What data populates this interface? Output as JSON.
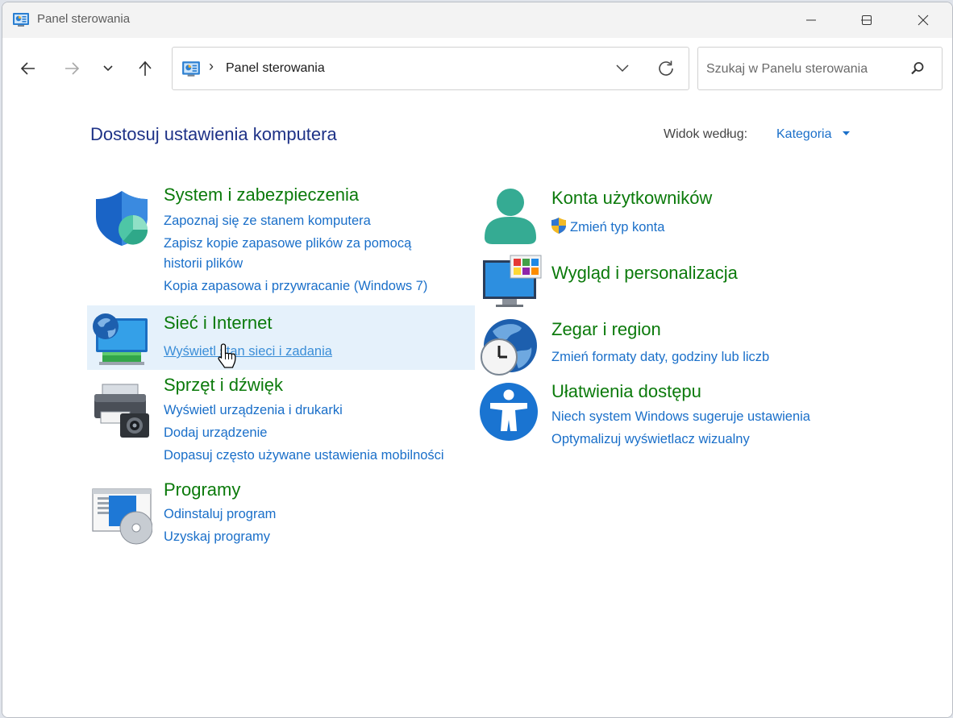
{
  "window": {
    "title": "Panel sterowania"
  },
  "nav": {
    "breadcrumb": "Panel sterowania",
    "search_placeholder": "Szukaj w Panelu sterowania"
  },
  "page": {
    "title": "Dostosuj ustawienia komputera",
    "viewby_label": "Widok według:",
    "viewby_value": "Kategoria"
  },
  "categories": {
    "system": {
      "title": "System i zabezpieczenia",
      "links": [
        "Zapoznaj się ze stanem komputera",
        "Zapisz kopie zapasowe plików za pomocą",
        "historii plików",
        "Kopia zapasowa i przywracanie (Windows 7)"
      ]
    },
    "network": {
      "title": "Sieć i Internet",
      "links": [
        "Wyświetl stan sieci i zadania"
      ]
    },
    "hardware": {
      "title": "Sprzęt i dźwięk",
      "links": [
        "Wyświetl urządzenia i drukarki",
        "Dodaj urządzenie",
        "Dopasuj często używane ustawienia mobilności"
      ]
    },
    "programs": {
      "title": "Programy",
      "links": [
        "Odinstaluj program",
        "Uzyskaj programy"
      ]
    },
    "accounts": {
      "title": "Konta użytkowników",
      "links": [
        "Zmień typ konta"
      ]
    },
    "appearance": {
      "title": "Wygląd i personalizacja",
      "links": []
    },
    "clock": {
      "title": "Zegar i region",
      "links": [
        "Zmień formaty daty, godziny lub liczb"
      ]
    },
    "ease": {
      "title": "Ułatwienia dostępu",
      "links": [
        "Niech system Windows sugeruje ustawienia",
        "Optymalizuj wyświetlacz wizualny"
      ]
    }
  },
  "colors": {
    "title_blue": "#1e3287",
    "category_green": "#0b7a0b",
    "link_blue": "#1a6fc9",
    "hover_bg": "#e5f1fb"
  },
  "icons": [
    "control-panel-icon",
    "minimize-icon",
    "maximize-icon",
    "close-icon",
    "back-arrow-icon",
    "forward-arrow-icon",
    "recent-dropdown-icon",
    "up-arrow-icon",
    "chevron-down-icon",
    "refresh-icon",
    "search-icon",
    "shield-icon",
    "network-globe-icon",
    "printer-camera-icon",
    "programs-disc-icon",
    "user-account-icon",
    "uac-shield-icon",
    "monitor-personalization-icon",
    "globe-clock-icon",
    "accessibility-icon",
    "hand-cursor-icon"
  ]
}
